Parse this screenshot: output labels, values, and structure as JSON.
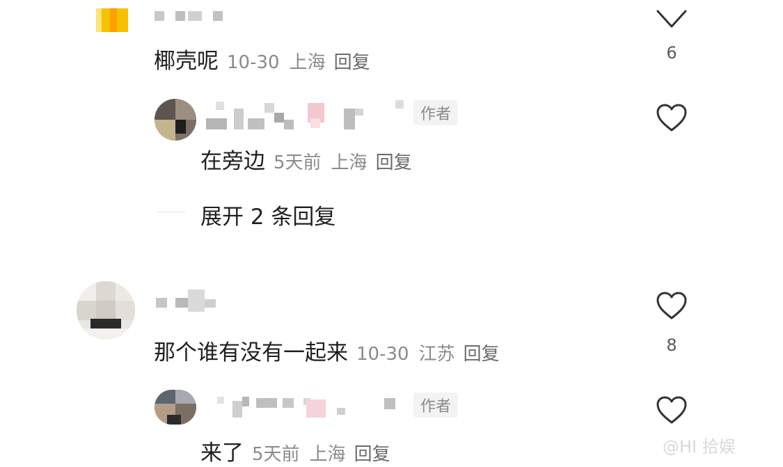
{
  "comments": [
    {
      "content": "椰壳呢",
      "date": "10-30",
      "location": "上海",
      "reply_label": "回复",
      "like_count": "6",
      "reply": {
        "author_tag": "作者",
        "content": "在旁边",
        "date": "5天前",
        "location": "上海",
        "reply_label": "回复"
      },
      "expand_label": "展开 2 条回复"
    },
    {
      "content": "那个谁有没有一起来",
      "date": "10-30",
      "location": "江苏",
      "reply_label": "回复",
      "like_count": "8",
      "reply": {
        "author_tag": "作者",
        "content": "来了",
        "date": "5天前",
        "location": "上海",
        "reply_label": "回复"
      }
    }
  ],
  "watermark": "@HI 拾娱",
  "icons": {
    "like": "heart-outline-icon",
    "collapse": "chevron-down-icon"
  },
  "colors": {
    "icon_stroke": "#333333",
    "meta_text": "#8a8a8a",
    "main_text": "#1f1f1f"
  }
}
